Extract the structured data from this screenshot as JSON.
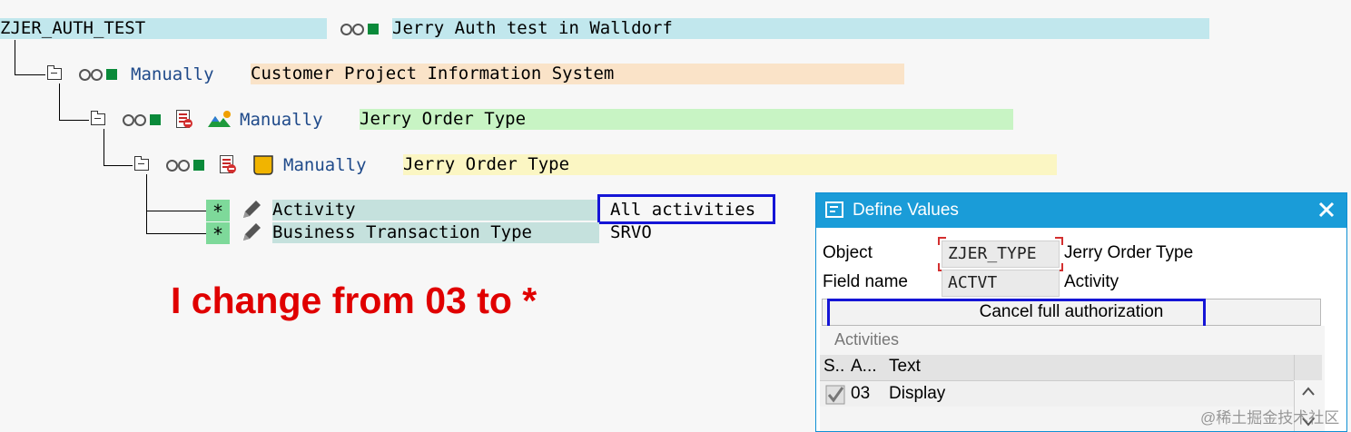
{
  "tree": {
    "root": {
      "name": "ZJER_AUTH_TEST",
      "description": "Jerry Auth test in Walldorf"
    },
    "level1": {
      "status": "Manually",
      "description": "Customer Project Information System"
    },
    "level2": {
      "status": "Manually",
      "description": "Jerry Order Type"
    },
    "level3": {
      "status": "Manually",
      "description": "Jerry Order Type"
    },
    "fields": [
      {
        "marker": "*",
        "name": "Activity",
        "value": "All activities"
      },
      {
        "marker": "*",
        "name": "Business Transaction Type",
        "value": "SRVO"
      }
    ]
  },
  "annotation": {
    "text": "I change from 03 to *",
    "color": "#e00000"
  },
  "dialog": {
    "title": "Define Values",
    "close_icon": "close-icon",
    "object_label": "Object",
    "object_value": "ZJER_TYPE",
    "object_text": "Jerry Order Type",
    "field_label": "Field name",
    "field_value": "ACTVT",
    "field_text": "Activity",
    "cancel_button": "Cancel full authorization",
    "group_title": "Activities",
    "table": {
      "headers": [
        "S..",
        "A...",
        "Text"
      ],
      "rows": [
        {
          "selected": true,
          "code": "03",
          "text": "Display"
        }
      ]
    }
  },
  "watermark": "@稀土掘金技术社区",
  "colors": {
    "highlight_box": "#1515d6",
    "dialog_header": "#1a9cd8",
    "status_green": "#0a8a3a"
  }
}
